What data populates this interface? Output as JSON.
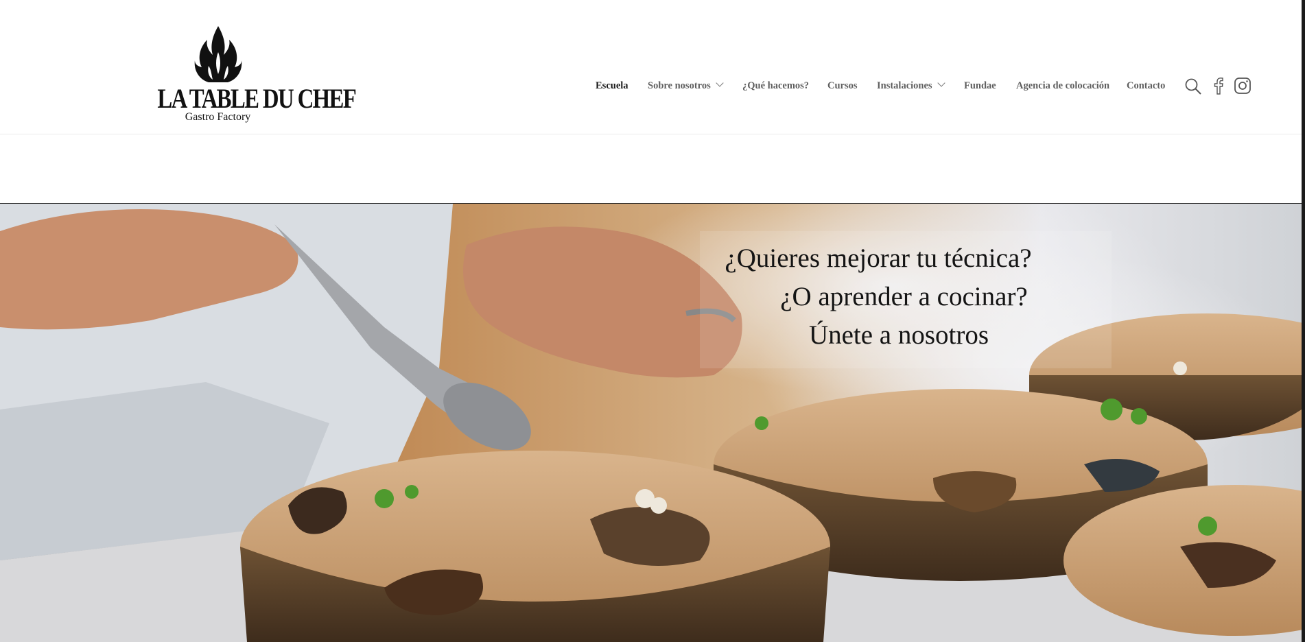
{
  "logo": {
    "title": "LA TABLE DU CHEF",
    "subtitle": "Gastro Factory"
  },
  "nav": {
    "items": [
      {
        "label": "Escuela",
        "active": true,
        "dropdown": false
      },
      {
        "label": "Sobre nosotros",
        "active": false,
        "dropdown": true
      },
      {
        "label": "¿Qué hacemos?",
        "active": false,
        "dropdown": false
      },
      {
        "label": "Cursos",
        "active": false,
        "dropdown": false
      },
      {
        "label": "Instalaciones",
        "active": false,
        "dropdown": true
      },
      {
        "label": "Fundae",
        "active": false,
        "dropdown": false
      },
      {
        "label": "Agencia de colocación",
        "active": false,
        "dropdown": false
      },
      {
        "label": "Contacto",
        "active": false,
        "dropdown": false
      }
    ],
    "icons": [
      "search-icon",
      "facebook-icon",
      "instagram-icon"
    ]
  },
  "hero": {
    "lines": [
      "¿Quieres mejorar tu técnica?",
      "¿O aprender a cocinar?",
      "Únete a nosotros"
    ]
  },
  "colors": {
    "nav_text": "#5f5f5f",
    "nav_active": "#1a1a1a",
    "hero_text": "#141414"
  }
}
